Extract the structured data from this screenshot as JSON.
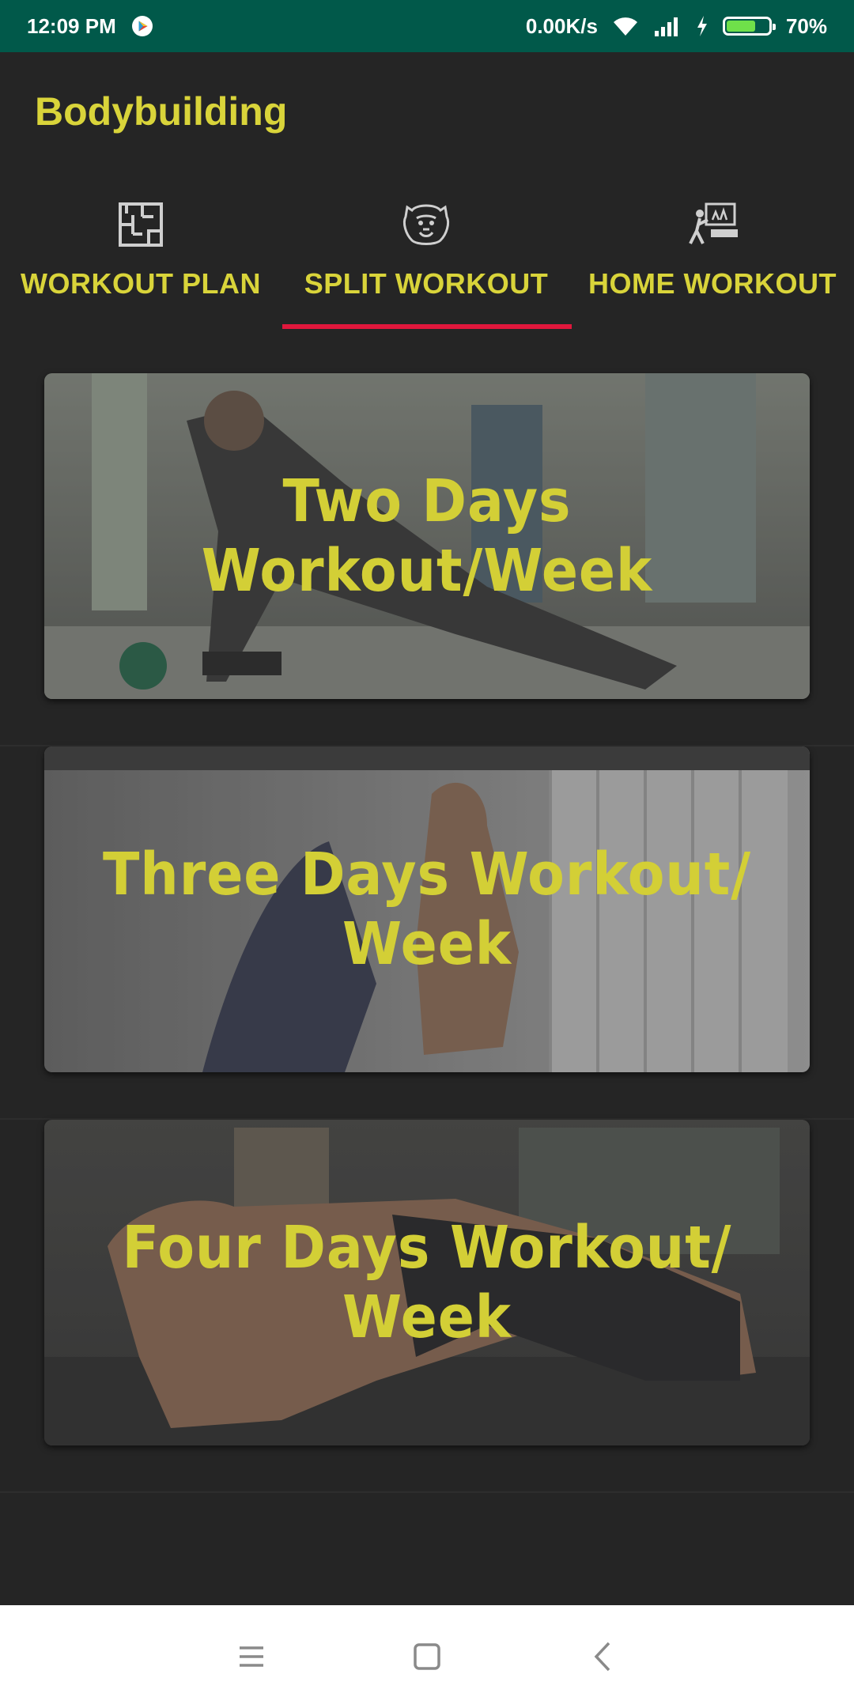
{
  "status_bar": {
    "time": "12:09 PM",
    "network_speed": "0.00K/s",
    "battery_percent": "70%",
    "battery_level": 0.7,
    "icons": [
      "play-store-icon",
      "wifi-icon",
      "signal-icon",
      "charging-icon",
      "battery-icon"
    ]
  },
  "app": {
    "title": "Bodybuilding",
    "accent_color": "#d9d43a",
    "indicator_color": "#e0173c"
  },
  "tabs": [
    {
      "label": "WORKOUT PLAN",
      "icon": "floor-plan-icon",
      "selected": false
    },
    {
      "label": "SPLIT WORKOUT",
      "icon": "gorilla-icon",
      "selected": true
    },
    {
      "label": "HOME WORKOUT",
      "icon": "home-training-icon",
      "selected": false
    }
  ],
  "cards": [
    {
      "title": "Two Days Workout/Week"
    },
    {
      "title": "Three Days Workout/ Week"
    },
    {
      "title": "Four Days Workout/ Week"
    }
  ],
  "nav_bar": {
    "icons": [
      "menu-icon",
      "home-icon",
      "back-icon"
    ]
  }
}
